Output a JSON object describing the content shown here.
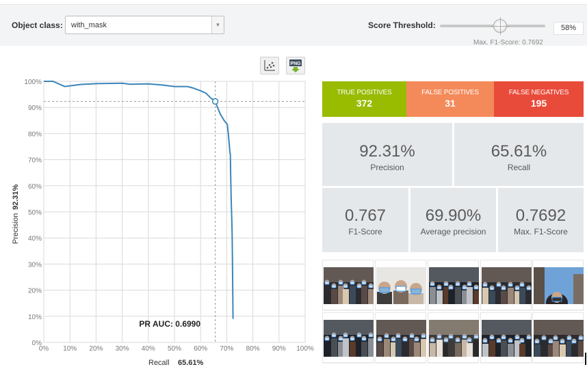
{
  "controls": {
    "object_class_label": "Object class:",
    "object_class_value": "with_mask",
    "score_threshold_label": "Score Threshold:",
    "score_threshold_value": "58%",
    "max_f1_note": "Max. F1-Score: 0.7692",
    "slider_fraction": 0.58
  },
  "toolbar": {
    "scatter_icon": "scatter-plot-icon",
    "png_icon": "png-download-icon",
    "png_text": "PNG"
  },
  "chart_data": {
    "type": "line",
    "xlabel": "Recall",
    "xlabel_value": "65.61%",
    "ylabel": "Precision",
    "ylabel_value": "92.31%",
    "xlim": [
      0,
      100
    ],
    "ylim": [
      0,
      100
    ],
    "x_ticks": [
      "0%",
      "10%",
      "20%",
      "30%",
      "40%",
      "50%",
      "60%",
      "70%",
      "80%",
      "90%",
      "100%"
    ],
    "y_ticks": [
      "0%",
      "10%",
      "20%",
      "30%",
      "40%",
      "50%",
      "60%",
      "70%",
      "80%",
      "90%",
      "100%"
    ],
    "grid": true,
    "annotation": "PR AUC: 0.6990",
    "marker": {
      "x": 65.61,
      "y": 92.31
    },
    "series": [
      {
        "color": "#3a85b8",
        "points": [
          [
            0,
            100
          ],
          [
            3.5,
            100
          ],
          [
            8,
            98
          ],
          [
            14,
            98.8
          ],
          [
            20,
            99.1
          ],
          [
            30,
            99.3
          ],
          [
            33,
            98.9
          ],
          [
            40,
            99
          ],
          [
            45,
            98.6
          ],
          [
            50,
            98
          ],
          [
            55,
            98
          ],
          [
            57,
            97.5
          ],
          [
            60,
            96.4
          ],
          [
            62,
            95.5
          ],
          [
            64,
            93.5
          ],
          [
            65.6,
            92.3
          ],
          [
            66.5,
            90
          ],
          [
            67.5,
            87.5
          ],
          [
            69,
            85
          ],
          [
            70.2,
            83.5
          ],
          [
            70.6,
            80
          ],
          [
            71.2,
            73
          ],
          [
            71.4,
            72
          ],
          [
            71.5,
            65
          ],
          [
            71.7,
            55
          ],
          [
            72,
            45
          ],
          [
            72.1,
            40
          ],
          [
            72.2,
            30
          ],
          [
            72.3,
            20
          ],
          [
            72.4,
            9
          ]
        ]
      }
    ]
  },
  "stats": {
    "true_positives": {
      "label": "TRUE POSITIVES",
      "value": "372",
      "color": "#99bb00"
    },
    "false_positives": {
      "label": "FALSE POSITIVES",
      "value": "31",
      "color": "#f48a5a"
    },
    "false_negatives": {
      "label": "FALSE NEGATIVES",
      "value": "195",
      "color": "#e94b3a"
    }
  },
  "metrics": {
    "precision": {
      "value": "92.31%",
      "label": "Precision"
    },
    "recall": {
      "value": "65.61%",
      "label": "Recall"
    },
    "f1": {
      "value": "0.767",
      "label": "F1-Score"
    },
    "ap": {
      "value": "69.90%",
      "label": "Average precision"
    },
    "max_f1": {
      "value": "0.7692",
      "label": "Max. F1-Score"
    }
  },
  "thumbnails": [
    {
      "kind": "crowd"
    },
    {
      "kind": "closeup"
    },
    {
      "kind": "crowd"
    },
    {
      "kind": "crowd"
    },
    {
      "kind": "sky"
    },
    {
      "kind": "crowd"
    },
    {
      "kind": "crowd"
    },
    {
      "kind": "crowd"
    },
    {
      "kind": "crowd"
    },
    {
      "kind": "crowd"
    }
  ]
}
